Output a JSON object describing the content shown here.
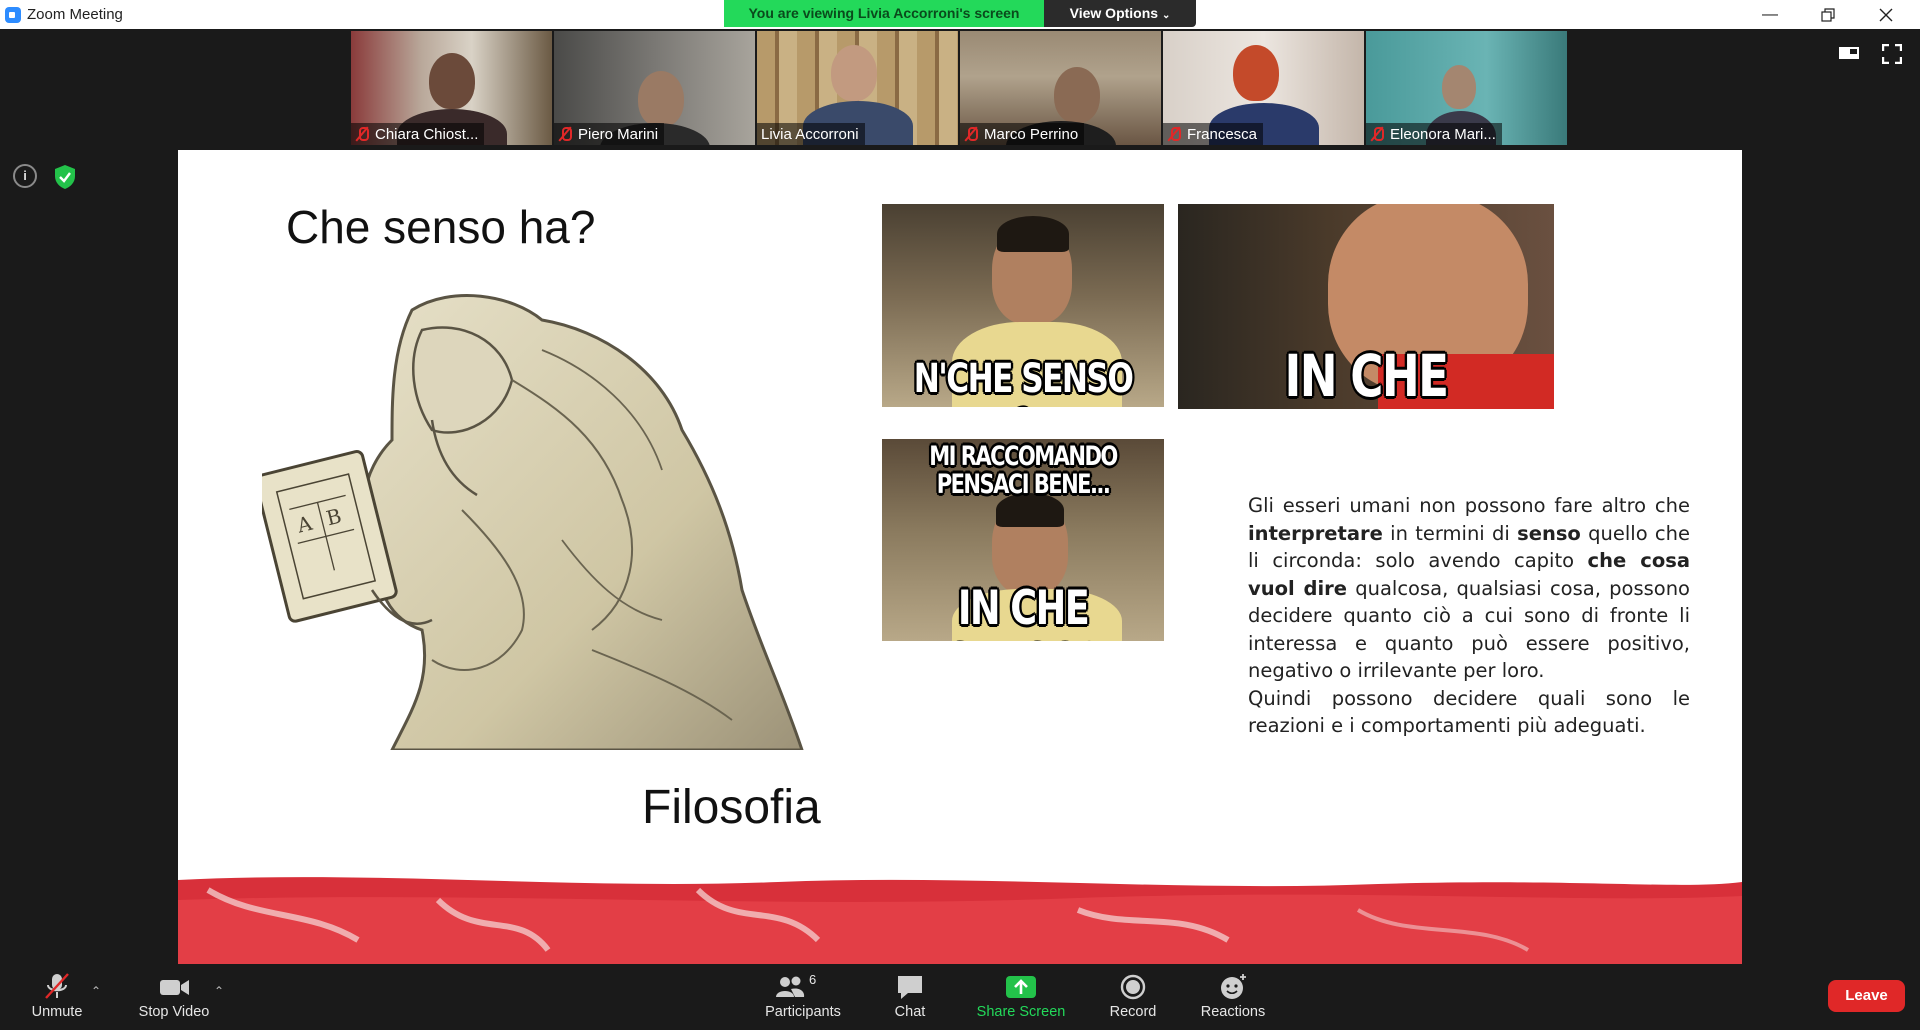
{
  "window": {
    "title": "Zoom Meeting",
    "controls": [
      "minimize",
      "restore",
      "close"
    ]
  },
  "banner": {
    "viewing_text": "You are viewing Livia Accorroni's screen",
    "view_options_label": "View Options"
  },
  "participants_strip": [
    {
      "name": "Chiara Chiost...",
      "muted": true
    },
    {
      "name": "Piero Marini",
      "muted": true
    },
    {
      "name": "Livia Accorroni",
      "muted": false,
      "active_speaker": true
    },
    {
      "name": "Marco Perrino",
      "muted": true
    },
    {
      "name": "Francesca",
      "muted": true
    },
    {
      "name": "Eleonora Mari...",
      "muted": true
    }
  ],
  "slide": {
    "title": "Che senso ha?",
    "subtitle": "Filosofia",
    "memes": [
      {
        "caption": "N'CHE SENSO ?"
      },
      {
        "caption": "IN CHE SENSO?"
      },
      {
        "caption_top": "MI RACCOMANDO PENSACI BENE...",
        "caption_bottom": "IN CHE SENSO?"
      }
    ],
    "body": {
      "p1_a": "Gli esseri umani non possono fare altro che ",
      "p1_b": "interpretare",
      "p1_c": " in termini di ",
      "p1_d": "senso",
      "p1_e": " quello che li circonda: solo avendo capito ",
      "p1_f": "che cosa vuol dire",
      "p1_g": " qualcosa, qualsiasi cosa, possono decidere quanto ciò a cui sono di fronte li interessa e quanto può essere positivo, negativo o irrilevante per loro.",
      "p2": "Quindi possono decidere quali sono le reazioni e i comportamenti più adeguati."
    }
  },
  "toolbar": {
    "unmute_label": "Unmute",
    "stop_video_label": "Stop Video",
    "participants_label": "Participants",
    "participants_count": "6",
    "chat_label": "Chat",
    "share_screen_label": "Share Screen",
    "record_label": "Record",
    "reactions_label": "Reactions",
    "leave_label": "Leave"
  },
  "colors": {
    "banner_green": "#23d95a",
    "share_green": "#23d95a",
    "leave_red": "#e02828",
    "mute_red": "#e02828"
  }
}
